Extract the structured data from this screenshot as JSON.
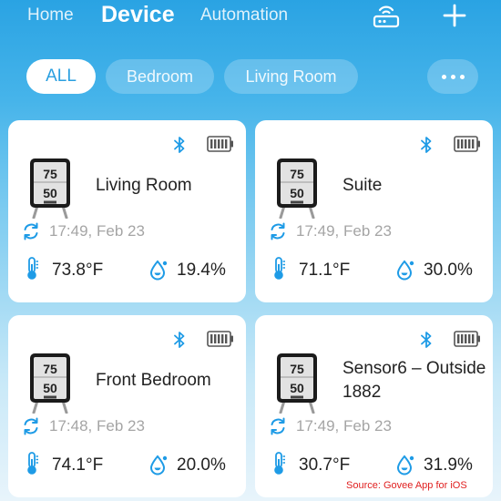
{
  "nav": {
    "tabs": [
      {
        "label": "Home"
      },
      {
        "label": "Device",
        "active": true
      },
      {
        "label": "Automation"
      }
    ],
    "icons": [
      "gateway-icon",
      "plus-icon"
    ]
  },
  "filters": {
    "chips": [
      {
        "label": "ALL",
        "active": true
      },
      {
        "label": "Bedroom"
      },
      {
        "label": "Living Room"
      }
    ],
    "more_icon": "more-dots-icon"
  },
  "devices": [
    {
      "name": "Living Room",
      "time": "17:49,  Feb 23",
      "temp": "73.8°F",
      "humidity": "19.4%"
    },
    {
      "name": "Suite",
      "time": "17:49,  Feb 23",
      "temp": "71.1°F",
      "humidity": "30.0%"
    },
    {
      "name": "Front Bedroom",
      "time": "17:48,  Feb 23",
      "temp": "74.1°F",
      "humidity": "20.0%"
    },
    {
      "name": "Sensor6 – Outside 1882",
      "time": "17:49,  Feb 23",
      "temp": "30.7°F",
      "humidity": "31.9%"
    }
  ],
  "device_display": {
    "temp_reading": "75",
    "humidity_reading": "50"
  },
  "colors": {
    "accent": "#2a9fe0",
    "icon_blue": "#1e9be6",
    "battery": "#555555"
  },
  "source_note": "Source: Govee App for iOS"
}
